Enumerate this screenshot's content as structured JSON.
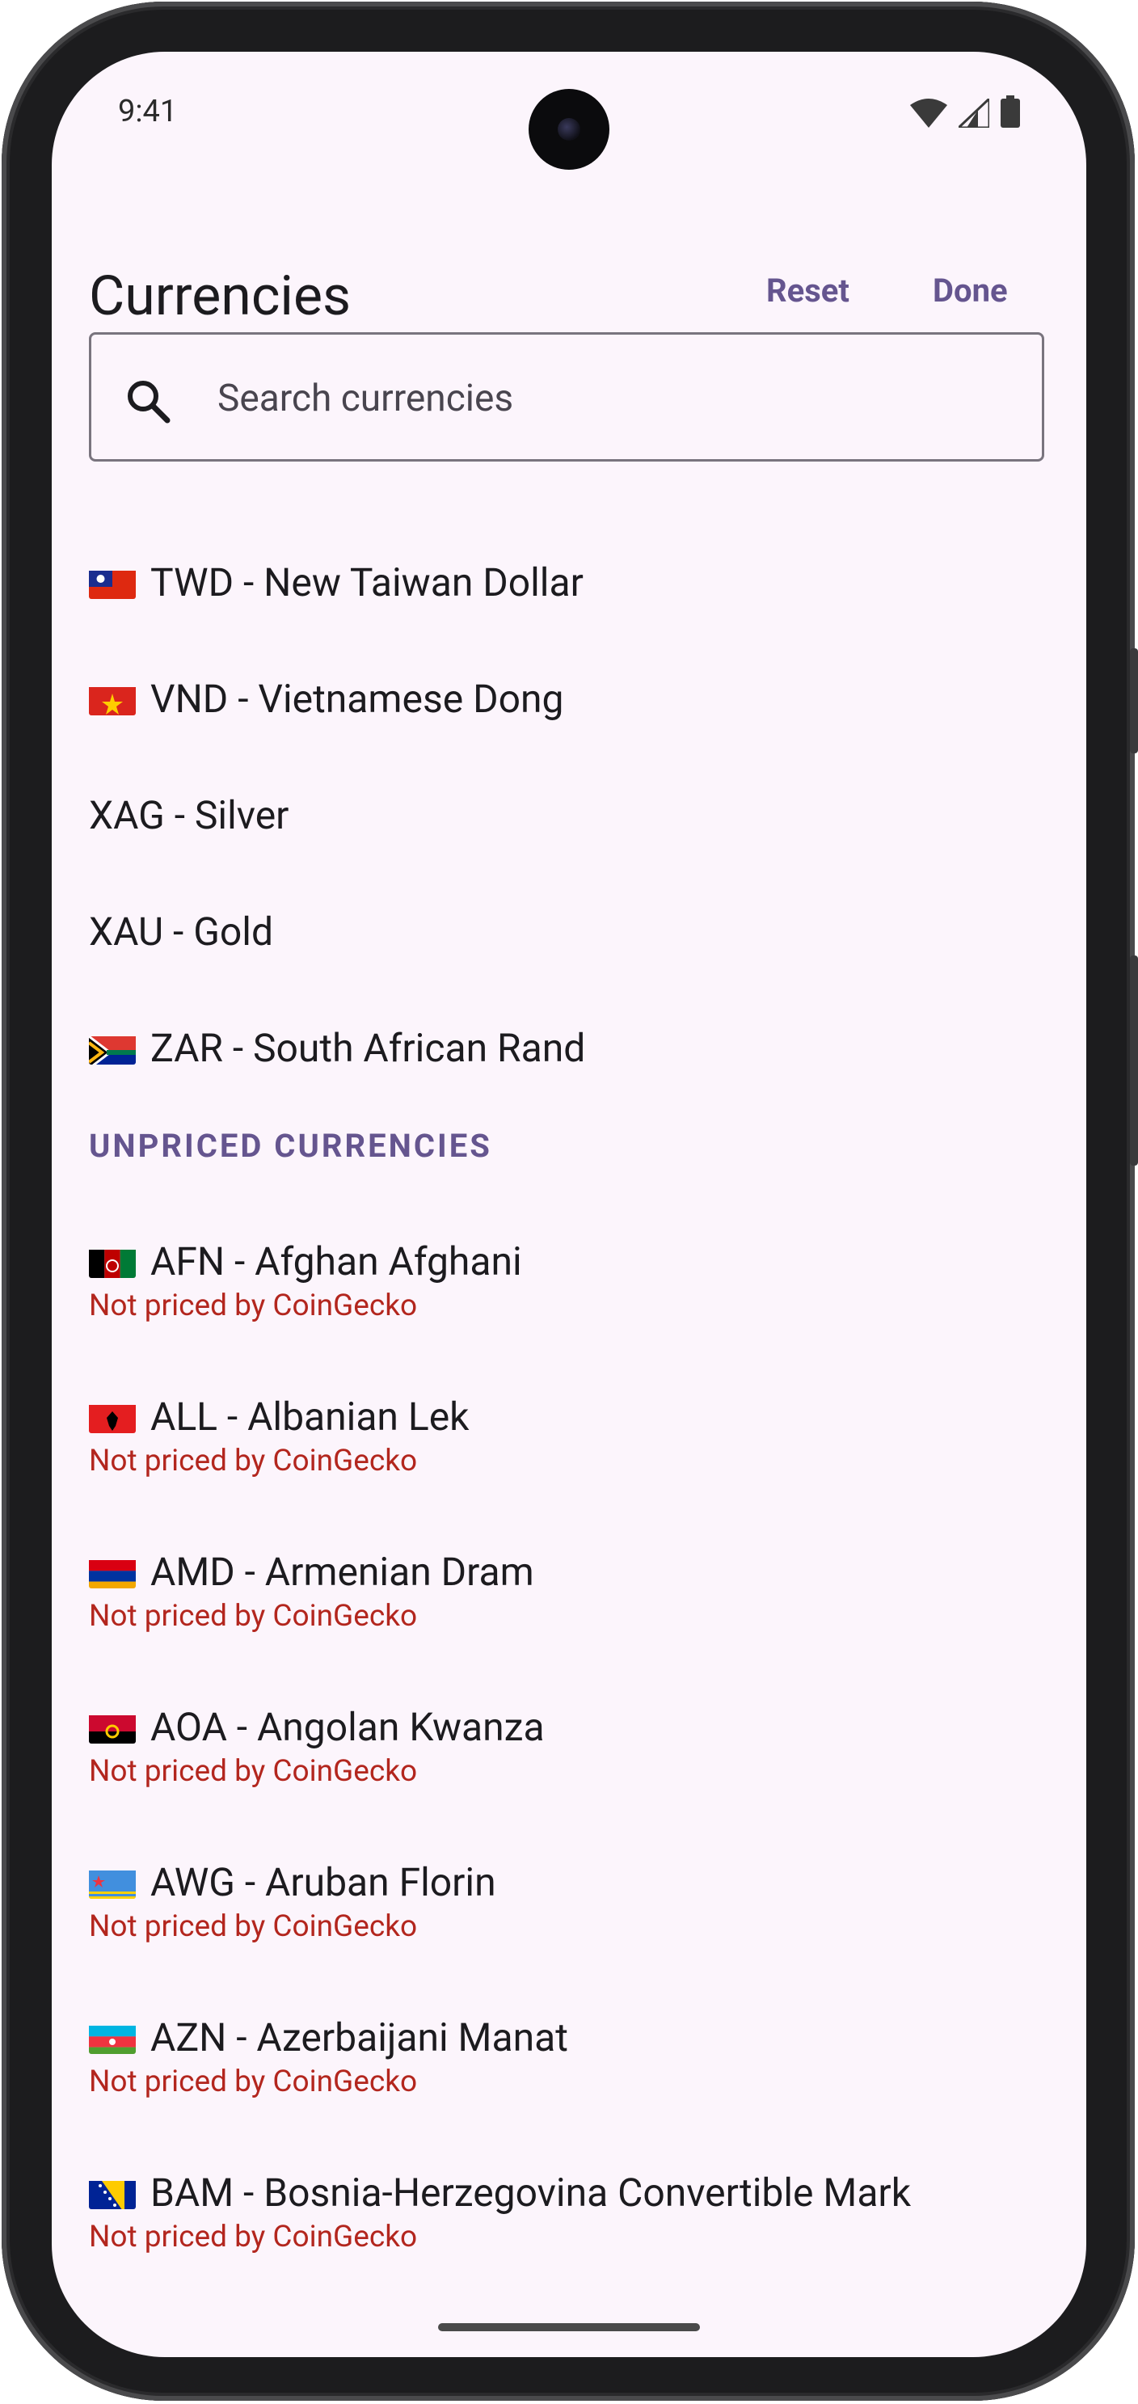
{
  "status_bar": {
    "time": "9:41"
  },
  "header": {
    "title": "Currencies",
    "reset_label": "Reset",
    "done_label": "Done"
  },
  "search": {
    "placeholder": "Search currencies"
  },
  "priced": [
    {
      "label": "TWD - New Taiwan Dollar",
      "flag": "TW"
    },
    {
      "label": "VND - Vietnamese Dong",
      "flag": "VN"
    },
    {
      "label": "XAG - Silver",
      "flag": null
    },
    {
      "label": "XAU - Gold",
      "flag": null
    },
    {
      "label": "ZAR - South African Rand",
      "flag": "ZA"
    }
  ],
  "unpriced_section_title": "UNPRICED CURRENCIES",
  "unpriced": [
    {
      "label": "AFN - Afghan Afghani",
      "flag": "AF",
      "note": "Not priced by CoinGecko"
    },
    {
      "label": "ALL - Albanian Lek",
      "flag": "AL",
      "note": "Not priced by CoinGecko"
    },
    {
      "label": "AMD - Armenian Dram",
      "flag": "AM",
      "note": "Not priced by CoinGecko"
    },
    {
      "label": "AOA - Angolan Kwanza",
      "flag": "AO",
      "note": "Not priced by CoinGecko"
    },
    {
      "label": "AWG - Aruban Florin",
      "flag": "AW",
      "note": "Not priced by CoinGecko"
    },
    {
      "label": "AZN - Azerbaijani Manat",
      "flag": "AZ",
      "note": "Not priced by CoinGecko"
    },
    {
      "label": "BAM - Bosnia-Herzegovina Convertible Mark",
      "flag": "BA",
      "note": "Not priced by CoinGecko"
    }
  ],
  "colors": {
    "accent": "#65558f",
    "warning": "#b3261e",
    "background": "#fcf5fc"
  },
  "icons": {
    "search": "search-icon",
    "wifi": "wifi-icon",
    "signal": "signal-icon",
    "battery": "battery-icon"
  }
}
